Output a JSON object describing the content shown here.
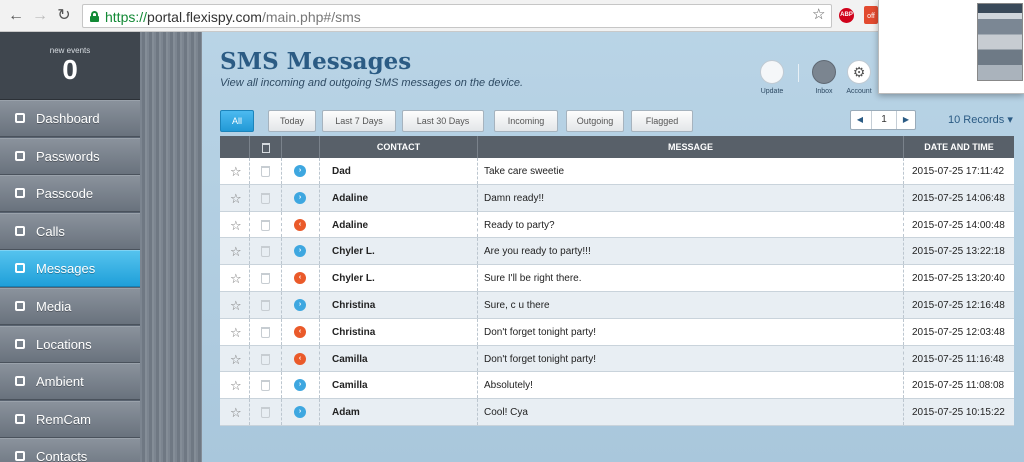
{
  "browser": {
    "url_scheme": "https://",
    "url_host": "portal.flexispy.com",
    "url_path": "/main.php#/sms",
    "abp_label": "ABP",
    "ext_label": "off"
  },
  "sidebar": {
    "events_label": "new events",
    "events_count": "0",
    "items": [
      {
        "label": "Dashboard",
        "icon": "rocket-icon"
      },
      {
        "label": "Passwords",
        "icon": "lock-icon"
      },
      {
        "label": "Passcode",
        "icon": "keypad-icon"
      },
      {
        "label": "Calls",
        "icon": "phone-icon"
      },
      {
        "label": "Messages",
        "icon": "chat-icon",
        "active": true
      },
      {
        "label": "Media",
        "icon": "image-icon"
      },
      {
        "label": "Locations",
        "icon": "pin-icon"
      },
      {
        "label": "Ambient",
        "icon": "microphone-icon"
      },
      {
        "label": "RemCam",
        "icon": "camera-icon"
      },
      {
        "label": "Contacts",
        "icon": "contacts-icon"
      }
    ]
  },
  "main": {
    "title": "SMS Messages",
    "subtitle": "View all incoming and outgoing SMS messages on the device.",
    "header_actions": [
      {
        "label": "Update",
        "icon": "update-icon"
      },
      {
        "label": "Inbox",
        "icon": "inbox-icon"
      },
      {
        "label": "Account",
        "icon": "gear-icon"
      }
    ],
    "filters": [
      "All",
      "Today",
      "Last 7 Days",
      "Last 30 Days",
      "Incoming",
      "Outgoing",
      "Flagged"
    ],
    "active_filter": "All",
    "page": "1",
    "records_label": "10 Records"
  },
  "table": {
    "headers": {
      "contact": "CONTACT",
      "message": "MESSAGE",
      "date": "DATE AND TIME"
    },
    "rows": [
      {
        "contact": "Dad",
        "message": "Take care sweetie",
        "date": "2015-07-25 17:11:42",
        "direction": "in"
      },
      {
        "contact": "Adaline",
        "message": "Damn ready!!",
        "date": "2015-07-25 14:06:48",
        "direction": "in"
      },
      {
        "contact": "Adaline",
        "message": "Ready to party?",
        "date": "2015-07-25 14:00:48",
        "direction": "out"
      },
      {
        "contact": "Chyler L.",
        "message": "Are you ready to party!!!",
        "date": "2015-07-25 13:22:18",
        "direction": "in"
      },
      {
        "contact": "Chyler L.",
        "message": "Sure I'll be right there.",
        "date": "2015-07-25 13:20:40",
        "direction": "out"
      },
      {
        "contact": "Christina",
        "message": "Sure, c u there",
        "date": "2015-07-25 12:16:48",
        "direction": "in"
      },
      {
        "contact": "Christina",
        "message": "Don't forget tonight party!",
        "date": "2015-07-25 12:03:48",
        "direction": "out"
      },
      {
        "contact": "Camilla",
        "message": "Don't forget tonight party!",
        "date": "2015-07-25 11:16:48",
        "direction": "out"
      },
      {
        "contact": "Camilla",
        "message": "Absolutely!",
        "date": "2015-07-25 11:08:08",
        "direction": "in"
      },
      {
        "contact": "Adam",
        "message": "Cool! Cya",
        "date": "2015-07-25 10:15:22",
        "direction": "in"
      }
    ]
  },
  "colors": {
    "accent": "#2299d6",
    "incoming": "#3ea7e0",
    "outgoing": "#ea5a2a",
    "title": "#2b5b84"
  }
}
